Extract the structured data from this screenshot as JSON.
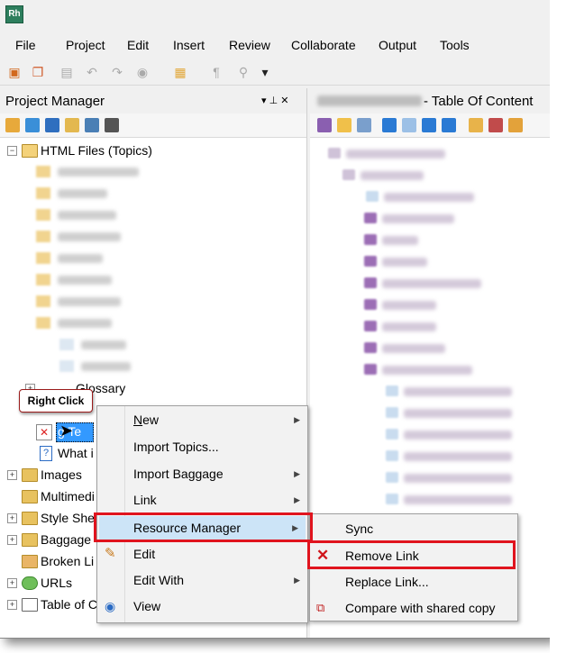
{
  "app": {
    "icon_label": "Rh"
  },
  "menubar": [
    "File",
    "Project",
    "Edit",
    "Insert",
    "Review",
    "Collaborate",
    "Output",
    "Tools"
  ],
  "project_manager": {
    "title": "Project Manager",
    "pin_label": "▾  ⊥  ✕",
    "tree": {
      "html_files": "HTML Files (Topics)",
      "glossary": "Glossary",
      "selected_topic": "g Te",
      "topic_2": "What i",
      "images": "Images",
      "multimedia": "Multimedi",
      "style_sheets": "Style She",
      "baggage": "Baggage",
      "broken_links": "Broken Li",
      "urls": "URLs",
      "toc": "Table of C"
    }
  },
  "right_pane": {
    "title": "- Table Of Content"
  },
  "callout": {
    "text": "Right Click"
  },
  "context_menu": {
    "items": [
      {
        "label": "New",
        "submenu": true
      },
      {
        "label": "Import Topics...",
        "submenu": false
      },
      {
        "label": "Import Baggage",
        "submenu": true
      },
      {
        "label": "Link",
        "submenu": true
      },
      {
        "label": "Resource Manager",
        "submenu": true
      },
      {
        "label": "Edit",
        "submenu": false
      },
      {
        "label": "Edit With",
        "submenu": true
      },
      {
        "label": "View",
        "submenu": false
      }
    ]
  },
  "submenu": {
    "items": [
      {
        "label": "Sync"
      },
      {
        "label": "Remove Link"
      },
      {
        "label": "Replace Link..."
      },
      {
        "label": "Compare with shared copy"
      }
    ]
  },
  "colors": {
    "highlight_border": "#e0141e",
    "menu_selection": "#cce4f7",
    "tree_selection": "#3399ff"
  }
}
